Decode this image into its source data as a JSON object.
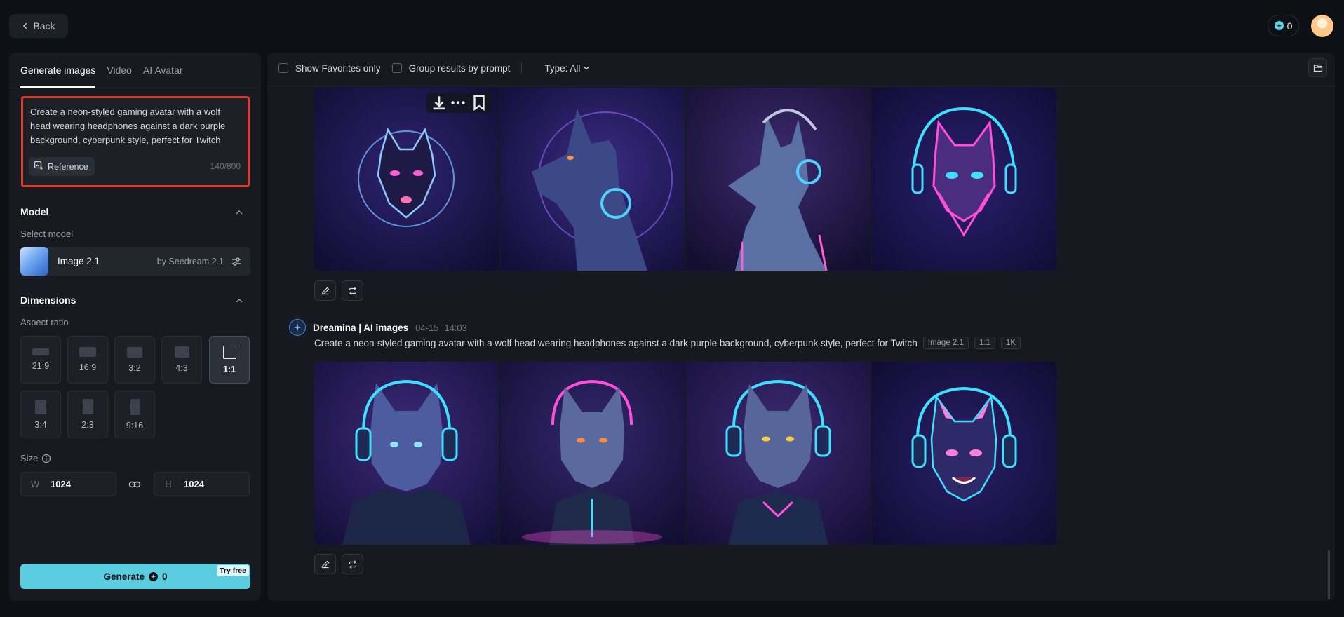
{
  "nav": {
    "back_label": "Back"
  },
  "account": {
    "credits": "0"
  },
  "left": {
    "tabs": [
      {
        "label": "Generate images"
      },
      {
        "label": "Video"
      },
      {
        "label": "AI Avatar"
      }
    ],
    "prompt": {
      "text": "Create a neon-styled gaming avatar with a wolf head wearing headphones against a dark purple background, cyberpunk style, perfect for Twitch",
      "reference_label": "Reference",
      "char_count": "140/800"
    },
    "model": {
      "section_title": "Model",
      "select_label": "Select model",
      "name": "Image 2.1",
      "by": "by Seedream 2.1"
    },
    "dimensions": {
      "section_title": "Dimensions",
      "aspect_label": "Aspect ratio",
      "ratios": [
        {
          "label": "21:9"
        },
        {
          "label": "16:9"
        },
        {
          "label": "3:2"
        },
        {
          "label": "4:3"
        },
        {
          "label": "1:1"
        },
        {
          "label": "3:4"
        },
        {
          "label": "2:3"
        },
        {
          "label": "9:16"
        }
      ],
      "selected_ratio": "1:1",
      "size_label": "Size",
      "width_prefix": "W",
      "width": "1024",
      "height_prefix": "H",
      "height": "1024"
    },
    "generate": {
      "label": "Generate",
      "cost": "0",
      "badge": "Try free"
    }
  },
  "results": {
    "filters": {
      "favorites_label": "Show Favorites only",
      "group_label": "Group results by prompt",
      "type_label": "Type: All"
    },
    "generation": {
      "author": "Dreamina | AI images",
      "date": "04-15",
      "time": "14:03",
      "prompt": "Create a neon-styled gaming avatar with a wolf head wearing headphones against a dark purple background, cyberpunk style, perfect for Twitch",
      "tags": [
        "Image 2.1",
        "1:1",
        "1K"
      ]
    }
  },
  "colors": {
    "accent": "#5bcde0",
    "highlight_border": "#e2392b",
    "neon_pink": "#ff4fd8",
    "neon_cyan": "#3fe0ff",
    "bg_purple": "#241a55"
  }
}
